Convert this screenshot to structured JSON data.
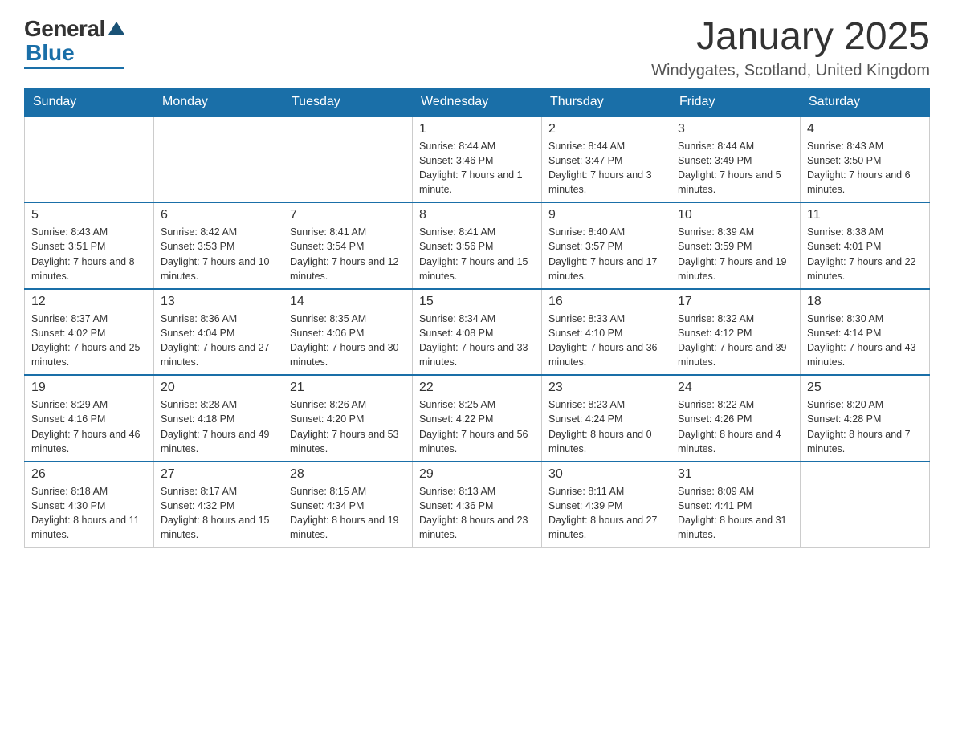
{
  "logo": {
    "general": "General",
    "blue": "Blue"
  },
  "title": "January 2025",
  "location": "Windygates, Scotland, United Kingdom",
  "days_of_week": [
    "Sunday",
    "Monday",
    "Tuesday",
    "Wednesday",
    "Thursday",
    "Friday",
    "Saturday"
  ],
  "weeks": [
    [
      {
        "day": "",
        "info": ""
      },
      {
        "day": "",
        "info": ""
      },
      {
        "day": "",
        "info": ""
      },
      {
        "day": "1",
        "info": "Sunrise: 8:44 AM\nSunset: 3:46 PM\nDaylight: 7 hours and 1 minute."
      },
      {
        "day": "2",
        "info": "Sunrise: 8:44 AM\nSunset: 3:47 PM\nDaylight: 7 hours and 3 minutes."
      },
      {
        "day": "3",
        "info": "Sunrise: 8:44 AM\nSunset: 3:49 PM\nDaylight: 7 hours and 5 minutes."
      },
      {
        "day": "4",
        "info": "Sunrise: 8:43 AM\nSunset: 3:50 PM\nDaylight: 7 hours and 6 minutes."
      }
    ],
    [
      {
        "day": "5",
        "info": "Sunrise: 8:43 AM\nSunset: 3:51 PM\nDaylight: 7 hours and 8 minutes."
      },
      {
        "day": "6",
        "info": "Sunrise: 8:42 AM\nSunset: 3:53 PM\nDaylight: 7 hours and 10 minutes."
      },
      {
        "day": "7",
        "info": "Sunrise: 8:41 AM\nSunset: 3:54 PM\nDaylight: 7 hours and 12 minutes."
      },
      {
        "day": "8",
        "info": "Sunrise: 8:41 AM\nSunset: 3:56 PM\nDaylight: 7 hours and 15 minutes."
      },
      {
        "day": "9",
        "info": "Sunrise: 8:40 AM\nSunset: 3:57 PM\nDaylight: 7 hours and 17 minutes."
      },
      {
        "day": "10",
        "info": "Sunrise: 8:39 AM\nSunset: 3:59 PM\nDaylight: 7 hours and 19 minutes."
      },
      {
        "day": "11",
        "info": "Sunrise: 8:38 AM\nSunset: 4:01 PM\nDaylight: 7 hours and 22 minutes."
      }
    ],
    [
      {
        "day": "12",
        "info": "Sunrise: 8:37 AM\nSunset: 4:02 PM\nDaylight: 7 hours and 25 minutes."
      },
      {
        "day": "13",
        "info": "Sunrise: 8:36 AM\nSunset: 4:04 PM\nDaylight: 7 hours and 27 minutes."
      },
      {
        "day": "14",
        "info": "Sunrise: 8:35 AM\nSunset: 4:06 PM\nDaylight: 7 hours and 30 minutes."
      },
      {
        "day": "15",
        "info": "Sunrise: 8:34 AM\nSunset: 4:08 PM\nDaylight: 7 hours and 33 minutes."
      },
      {
        "day": "16",
        "info": "Sunrise: 8:33 AM\nSunset: 4:10 PM\nDaylight: 7 hours and 36 minutes."
      },
      {
        "day": "17",
        "info": "Sunrise: 8:32 AM\nSunset: 4:12 PM\nDaylight: 7 hours and 39 minutes."
      },
      {
        "day": "18",
        "info": "Sunrise: 8:30 AM\nSunset: 4:14 PM\nDaylight: 7 hours and 43 minutes."
      }
    ],
    [
      {
        "day": "19",
        "info": "Sunrise: 8:29 AM\nSunset: 4:16 PM\nDaylight: 7 hours and 46 minutes."
      },
      {
        "day": "20",
        "info": "Sunrise: 8:28 AM\nSunset: 4:18 PM\nDaylight: 7 hours and 49 minutes."
      },
      {
        "day": "21",
        "info": "Sunrise: 8:26 AM\nSunset: 4:20 PM\nDaylight: 7 hours and 53 minutes."
      },
      {
        "day": "22",
        "info": "Sunrise: 8:25 AM\nSunset: 4:22 PM\nDaylight: 7 hours and 56 minutes."
      },
      {
        "day": "23",
        "info": "Sunrise: 8:23 AM\nSunset: 4:24 PM\nDaylight: 8 hours and 0 minutes."
      },
      {
        "day": "24",
        "info": "Sunrise: 8:22 AM\nSunset: 4:26 PM\nDaylight: 8 hours and 4 minutes."
      },
      {
        "day": "25",
        "info": "Sunrise: 8:20 AM\nSunset: 4:28 PM\nDaylight: 8 hours and 7 minutes."
      }
    ],
    [
      {
        "day": "26",
        "info": "Sunrise: 8:18 AM\nSunset: 4:30 PM\nDaylight: 8 hours and 11 minutes."
      },
      {
        "day": "27",
        "info": "Sunrise: 8:17 AM\nSunset: 4:32 PM\nDaylight: 8 hours and 15 minutes."
      },
      {
        "day": "28",
        "info": "Sunrise: 8:15 AM\nSunset: 4:34 PM\nDaylight: 8 hours and 19 minutes."
      },
      {
        "day": "29",
        "info": "Sunrise: 8:13 AM\nSunset: 4:36 PM\nDaylight: 8 hours and 23 minutes."
      },
      {
        "day": "30",
        "info": "Sunrise: 8:11 AM\nSunset: 4:39 PM\nDaylight: 8 hours and 27 minutes."
      },
      {
        "day": "31",
        "info": "Sunrise: 8:09 AM\nSunset: 4:41 PM\nDaylight: 8 hours and 31 minutes."
      },
      {
        "day": "",
        "info": ""
      }
    ]
  ]
}
